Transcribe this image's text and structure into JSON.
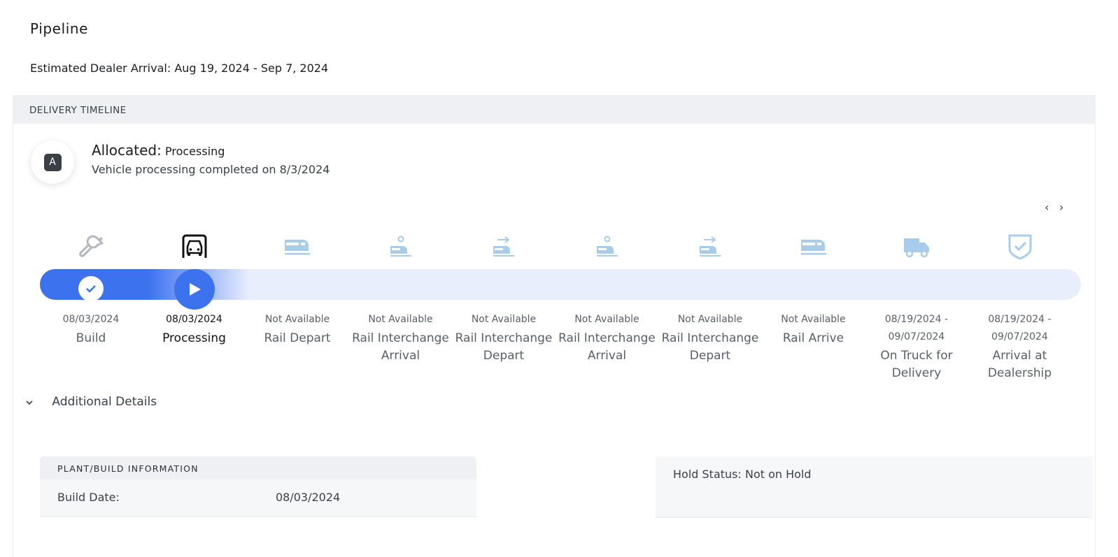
{
  "page": {
    "title": "Pipeline",
    "eta_label": "Estimated Dealer Arrival:",
    "eta_value": "Aug 19, 2024 - Sep 7, 2024"
  },
  "timeline": {
    "header": "DELIVERY TIMELINE",
    "status": {
      "badge": "A",
      "label": "Allocated:",
      "value": "Processing",
      "description": "Vehicle processing completed on 8/3/2024"
    },
    "pager": {
      "prev": "‹",
      "next": "›"
    },
    "progress_color": "#3d72ef",
    "track_color": "#e8eefc",
    "icon_color_done": "#b5b7bc",
    "icon_color_pending": "#a8cdea",
    "steps": [
      {
        "icon": "wrench-icon",
        "date": "08/03/2024",
        "label": "Build",
        "state": "done"
      },
      {
        "icon": "vehicle-processing-icon",
        "date": "08/03/2024",
        "label": "Processing",
        "state": "current"
      },
      {
        "icon": "train-icon",
        "date": "Not Available",
        "label": "Rail Depart",
        "state": "pending"
      },
      {
        "icon": "rail-interchange-arrival-icon",
        "date": "Not Available",
        "label": "Rail Interchange Arrival",
        "state": "pending"
      },
      {
        "icon": "rail-interchange-depart-icon",
        "date": "Not Available",
        "label": "Rail Interchange Depart",
        "state": "pending"
      },
      {
        "icon": "rail-interchange-arrival-icon",
        "date": "Not Available",
        "label": "Rail Interchange Arrival",
        "state": "pending"
      },
      {
        "icon": "rail-interchange-depart-icon",
        "date": "Not Available",
        "label": "Rail Interchange Depart",
        "state": "pending"
      },
      {
        "icon": "train-icon",
        "date": "Not Available",
        "label": "Rail Arrive",
        "state": "pending"
      },
      {
        "icon": "truck-icon",
        "date": "08/19/2024 - 09/07/2024",
        "label": "On Truck for Delivery",
        "state": "pending"
      },
      {
        "icon": "shield-check-icon",
        "date": "08/19/2024 - 09/07/2024",
        "label": "Arrival at Dealership",
        "state": "pending"
      }
    ]
  },
  "details": {
    "toggle_label": "Additional Details",
    "toggle_icon": "chevron-down-icon",
    "plant": {
      "header": "PLANT/BUILD INFORMATION",
      "build_date_label": "Build Date:",
      "build_date_value": "08/03/2024"
    },
    "hold": {
      "text": "Hold Status: Not on Hold"
    }
  }
}
